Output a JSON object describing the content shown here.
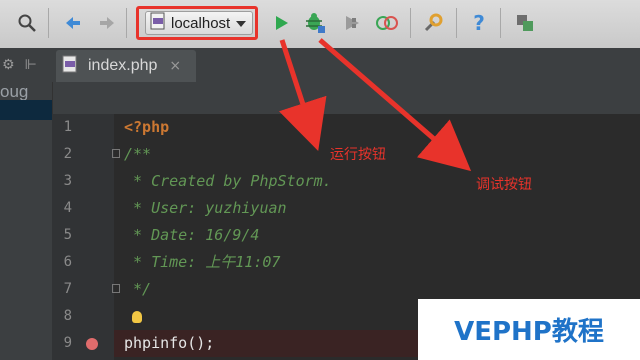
{
  "toolbar": {
    "run_config_label": "localhost",
    "help_glyph": "?",
    "icons": [
      "find-icon",
      "back-arrow-icon",
      "forward-arrow-icon",
      "php-file-icon",
      "dropdown-icon",
      "run-icon",
      "debug-icon",
      "coverage-icon",
      "stop-icon",
      "settings-wrench-icon",
      "help-icon",
      "vcs-icon"
    ]
  },
  "editor": {
    "tab_label": "index.php",
    "tab_close_glyph": "×",
    "left_panel_label": "oug",
    "lines": [
      {
        "num": "1",
        "parts": [
          {
            "text": "<?php",
            "style": "kw"
          }
        ]
      },
      {
        "num": "2",
        "parts": [
          {
            "text": "/**",
            "style": "cm"
          }
        ]
      },
      {
        "num": "3",
        "parts": [
          {
            "text": " * Created by PhpStorm.",
            "style": "cm"
          }
        ]
      },
      {
        "num": "4",
        "parts": [
          {
            "text": " * User: yuzhiyuan",
            "style": "cm"
          }
        ]
      },
      {
        "num": "5",
        "parts": [
          {
            "text": " * Date: 16/9/4",
            "style": "cm"
          }
        ]
      },
      {
        "num": "6",
        "parts": [
          {
            "text": " * Time: 上午11:07",
            "style": "cm"
          }
        ]
      },
      {
        "num": "7",
        "parts": [
          {
            "text": " */",
            "style": "cm"
          }
        ]
      },
      {
        "num": "8",
        "parts": [
          {
            "text": "",
            "style": "plain"
          }
        ]
      },
      {
        "num": "9",
        "parts": [
          {
            "text": "phpinfo();",
            "style": "plain"
          }
        ]
      }
    ]
  },
  "annotations": {
    "run_button": "运行按钮",
    "debug_button": "调试按钮",
    "color": "#e8332b"
  },
  "watermark": "VEPHP教程"
}
